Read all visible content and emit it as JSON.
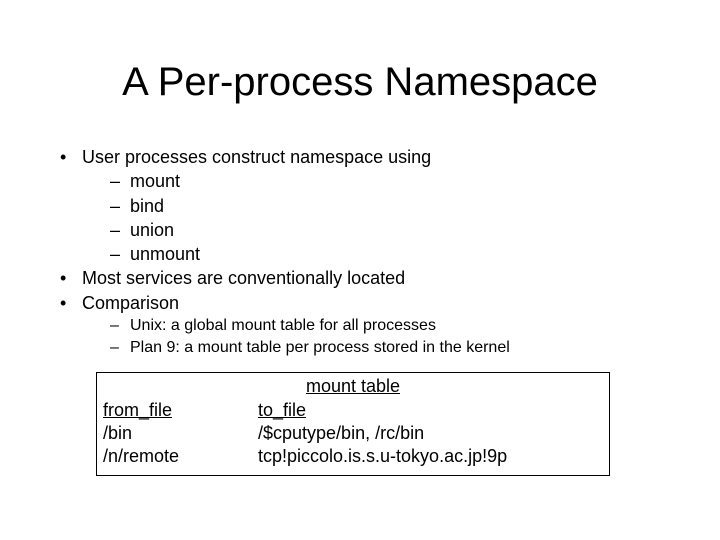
{
  "title": "A Per-process Namespace",
  "bullets": {
    "b1": "User processes construct namespace using",
    "b1_subs": {
      "s1": "mount",
      "s2": "bind",
      "s3": "union",
      "s4": "unmount"
    },
    "b2": "Most services are conventionally located",
    "b3": "Comparison",
    "b3_subs": {
      "s1": "Unix: a global mount table for all processes",
      "s2": "Plan 9: a mount table per process stored in the kernel"
    }
  },
  "table": {
    "title": "mount table",
    "headers": {
      "from": "from_file",
      "to": "to_file"
    },
    "rows": {
      "r0": {
        "from": "/bin",
        "to": "/$cputype/bin, /rc/bin"
      },
      "r1": {
        "from": "/n/remote",
        "to": "tcp!piccolo.is.s.u-tokyo.ac.jp!9p"
      }
    }
  }
}
